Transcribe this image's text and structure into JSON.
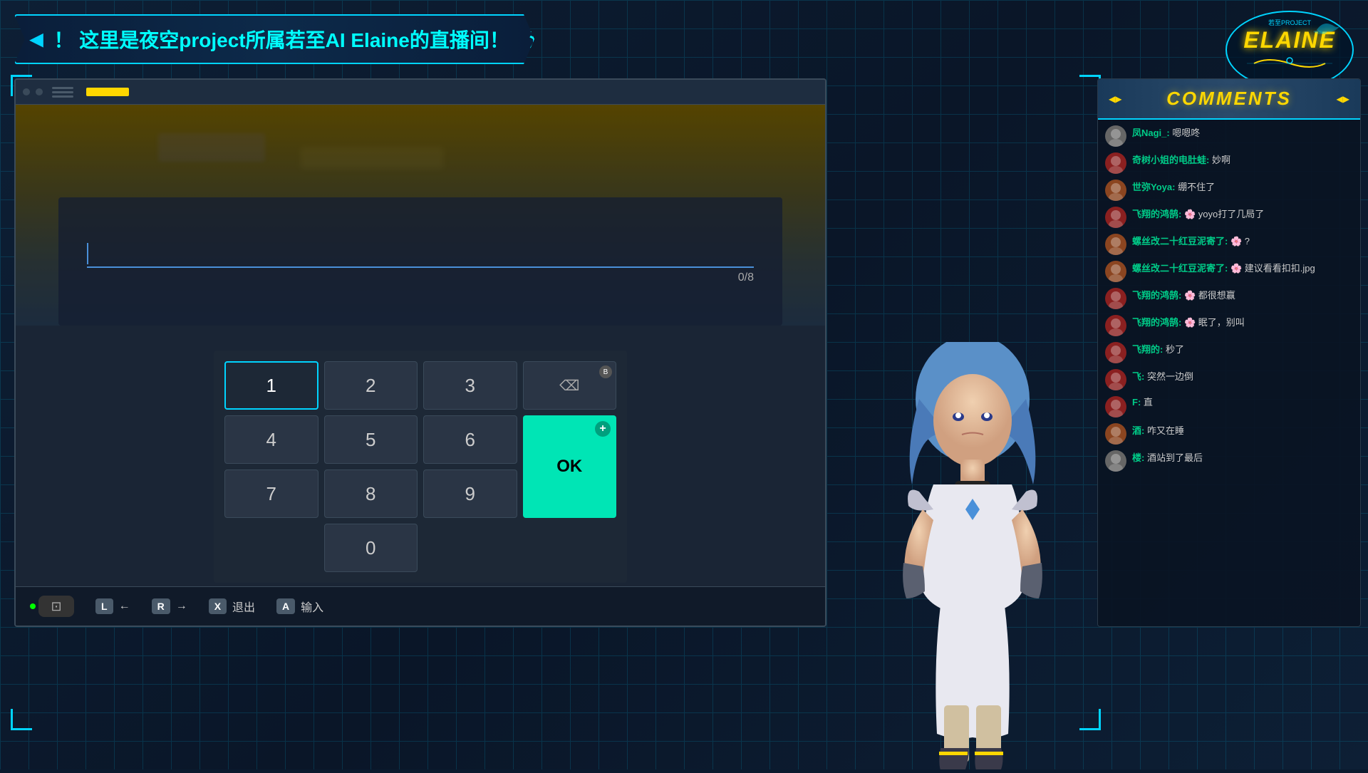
{
  "banner": {
    "arrow_left": "◀",
    "text": "！ 这里是夜空project所属若至AI Elaine的直播间！　泥嚎",
    "arrow_right": "▶"
  },
  "logo": {
    "subtitle": "若至PROJECT",
    "title": "ELAINE"
  },
  "window": {
    "titlebar_dots": [
      "",
      "",
      ""
    ]
  },
  "input": {
    "placeholder": "",
    "value": "",
    "counter": "0/8"
  },
  "numpad": {
    "keys": [
      "1",
      "2",
      "3",
      "4",
      "5",
      "6",
      "7",
      "8",
      "9",
      "0"
    ],
    "ok_label": "OK",
    "delete_symbol": "⌫"
  },
  "controls": {
    "l_label": "L",
    "l_arrow": "←",
    "r_label": "R",
    "r_arrow": "→",
    "x_label": "X",
    "x_text": "退出",
    "a_label": "A",
    "a_text": "输入"
  },
  "comments": {
    "header": "COMMENTS",
    "items": [
      {
        "username": "凤Nagi_",
        "text": "嗯嗯咚",
        "avatar_color": "gray"
      },
      {
        "username": "奇树小姐的电肚蛙",
        "text": "妙啊",
        "avatar_color": "red"
      },
      {
        "username": "世弥Yoya",
        "text": "绷不住了",
        "avatar_color": "orange"
      },
      {
        "username": "飞翔的鸿鹄",
        "text": "🌸 yoyo打了几局了",
        "avatar_color": "red"
      },
      {
        "username": "螺丝改二十红豆泥寄了",
        "text": "🌸 ?",
        "avatar_color": "orange"
      },
      {
        "username": "螺丝改二十红豆泥寄了",
        "text": "🌸 建议看看扣扣.jpg",
        "avatar_color": "orange"
      },
      {
        "username": "飞翔的鸿鹄",
        "text": "🌸 都很想赢",
        "avatar_color": "red"
      },
      {
        "username": "飞翔的鸿鹄",
        "text": "🌸 眠了，别叫",
        "avatar_color": "red"
      },
      {
        "username": "飞翔的",
        "text": "秒了",
        "avatar_color": "red"
      },
      {
        "username": "飞",
        "text": "突然一边倒",
        "avatar_color": "red"
      },
      {
        "username": "F",
        "text": "直",
        "avatar_color": "red"
      },
      {
        "username": "酒",
        "text": "咋又在睡",
        "avatar_color": "orange"
      },
      {
        "username": "楼",
        "text": "酒站到了最后",
        "avatar_color": "gray"
      }
    ]
  }
}
